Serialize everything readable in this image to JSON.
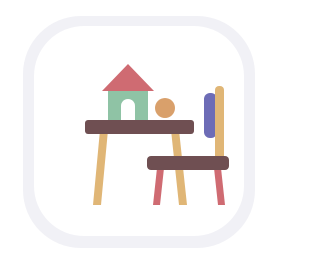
{
  "app_icon": {
    "icon": "kids-desk-with-toy-house-icon",
    "colors": {
      "tile_background": "#ffffff",
      "tile_border": "#f1f1f6",
      "roof": "#cf6b72",
      "house_body": "#8fc3a5",
      "house_door": "#ffffff",
      "ball": "#d9a06b",
      "desk_top": "#6f4f52",
      "desk_legs": "#e0b676",
      "chair_back": "#6d6cb6",
      "chair_post": "#e0b676",
      "chair_seat": "#6f4f52",
      "chair_legs": "#cf6b72"
    }
  }
}
